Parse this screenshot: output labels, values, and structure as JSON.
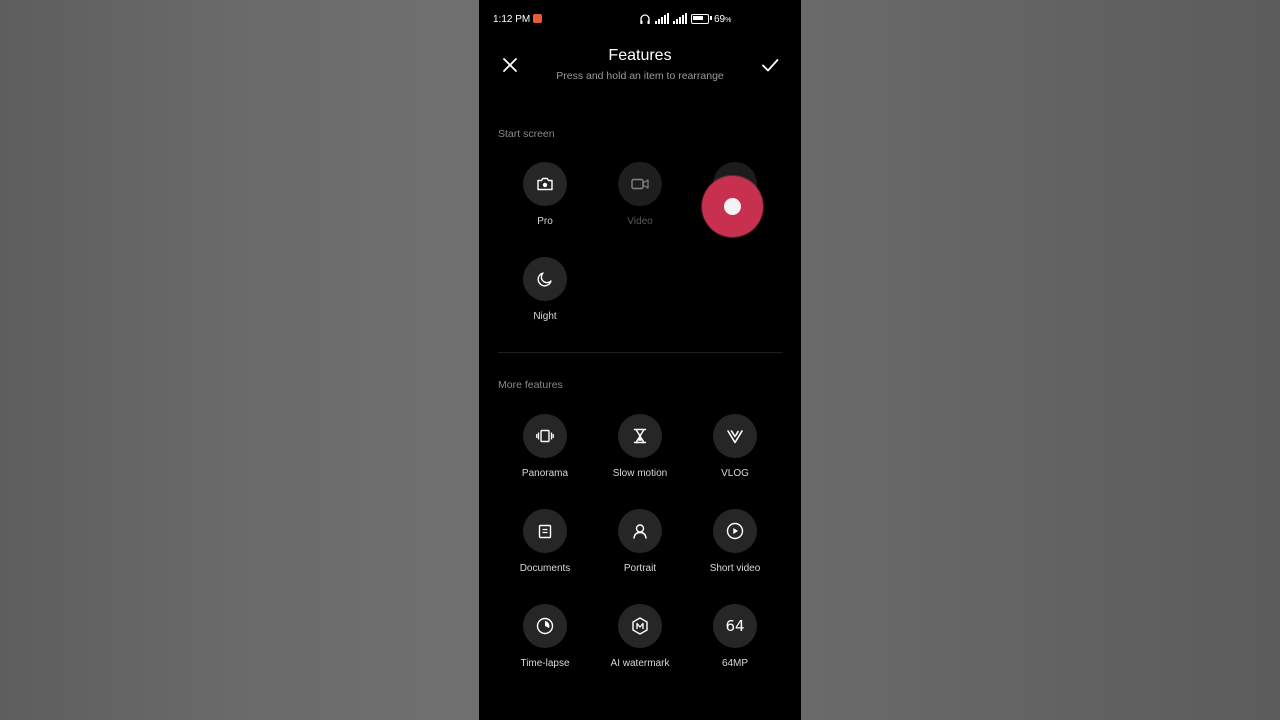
{
  "status_bar": {
    "time": "1:12 PM",
    "battery_percent": "69",
    "icons": [
      "recording-icon",
      "headphones-icon",
      "signal-icon",
      "signal-icon",
      "battery-icon"
    ]
  },
  "header": {
    "title": "Features",
    "subtitle": "Press and hold an item to rearrange",
    "close_icon": "close-icon",
    "confirm_icon": "check-icon"
  },
  "start_screen": {
    "label": "Start screen",
    "items": [
      {
        "label": "Pro",
        "icon": "camera-icon",
        "dimmed": false
      },
      {
        "label": "Video",
        "icon": "video-icon",
        "dimmed": true
      },
      {
        "label": "",
        "icon": "feature-icon",
        "dimmed": true
      },
      {
        "label": "Night",
        "icon": "moon-icon",
        "dimmed": false
      }
    ]
  },
  "more_features": {
    "label": "More features",
    "items": [
      {
        "label": "Panorama",
        "icon": "panorama-icon"
      },
      {
        "label": "Slow motion",
        "icon": "hourglass-icon"
      },
      {
        "label": "VLOG",
        "icon": "vlog-icon"
      },
      {
        "label": "Documents",
        "icon": "document-icon"
      },
      {
        "label": "Portrait",
        "icon": "portrait-icon"
      },
      {
        "label": "Short video",
        "icon": "play-icon"
      },
      {
        "label": "Time-lapse",
        "icon": "timelapse-icon"
      },
      {
        "label": "AI watermark",
        "icon": "watermark-icon"
      },
      {
        "label": "64MP",
        "icon": "64",
        "icon_text": "64"
      }
    ]
  },
  "colors": {
    "background": "#000000",
    "circle": "#262626",
    "touch_indicator": "#c7314f",
    "secondary_text": "#9a9a9a"
  }
}
